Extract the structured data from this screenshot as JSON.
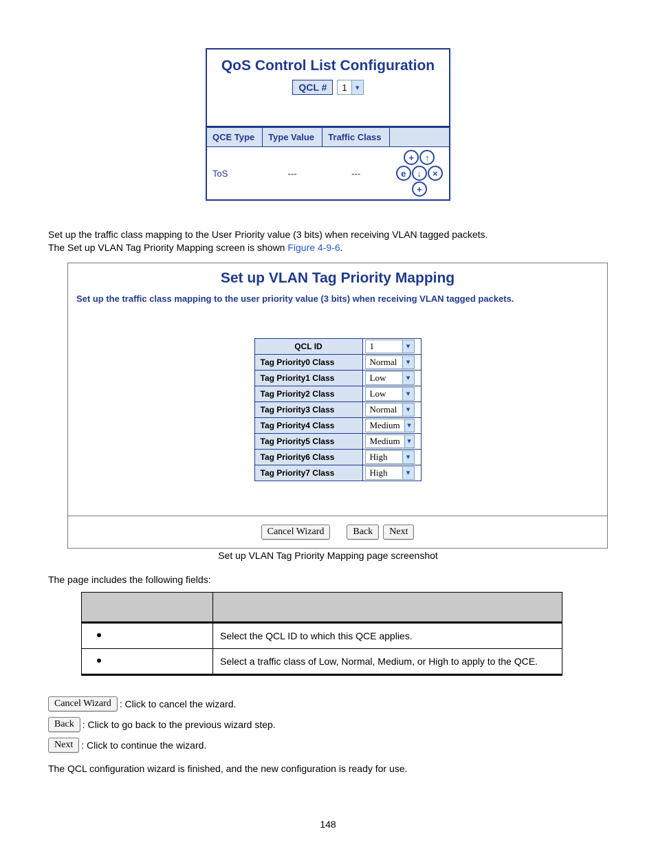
{
  "page_number": "148",
  "qos": {
    "title": "QoS Control List Configuration",
    "qcl_label": "QCL #",
    "qcl_value": "1",
    "headers": [
      "QCE Type",
      "Type Value",
      "Traffic Class"
    ],
    "row": {
      "qce_type": "ToS",
      "type_value": "---",
      "traffic_class": "---"
    }
  },
  "intro": {
    "l1": "Set up the traffic class mapping to the User Priority value (3 bits) when receiving VLAN tagged packets.",
    "l2a": "The Set up VLAN Tag Priority Mapping screen is shown ",
    "l2_link": "Figure 4-9-6",
    "l2b": "."
  },
  "vlan": {
    "title": "Set up VLAN Tag Priority Mapping",
    "subtitle": "Set up the traffic class mapping to the user priority value (3 bits) when receiving VLAN tagged packets.",
    "qcl_id_label": "QCL ID",
    "qcl_id_value": "1",
    "rows": [
      {
        "label": "Tag Priority0 Class",
        "value": "Normal"
      },
      {
        "label": "Tag Priority1 Class",
        "value": "Low"
      },
      {
        "label": "Tag Priority2 Class",
        "value": "Low"
      },
      {
        "label": "Tag Priority3 Class",
        "value": "Normal"
      },
      {
        "label": "Tag Priority4 Class",
        "value": "Medium"
      },
      {
        "label": "Tag Priority5 Class",
        "value": "Medium"
      },
      {
        "label": "Tag Priority6 Class",
        "value": "High"
      },
      {
        "label": "Tag Priority7 Class",
        "value": "High"
      }
    ],
    "btn_cancel": "Cancel Wizard",
    "btn_back": "Back",
    "btn_next": "Next",
    "caption": "Set up VLAN Tag Priority Mapping page screenshot"
  },
  "fields_intro": "The page includes the following fields:",
  "fields": [
    {
      "desc": "Select the QCL ID to which this QCE applies."
    },
    {
      "desc": "Select a traffic class of Low, Normal, Medium, or High to apply to the QCE."
    }
  ],
  "btn_desc": {
    "cancel": ": Click to cancel the wizard.",
    "back": ": Click to go back to the previous wizard step.",
    "next": ": Click to continue the wizard."
  },
  "closing": "The QCL configuration wizard is finished, and the new configuration is ready for use."
}
